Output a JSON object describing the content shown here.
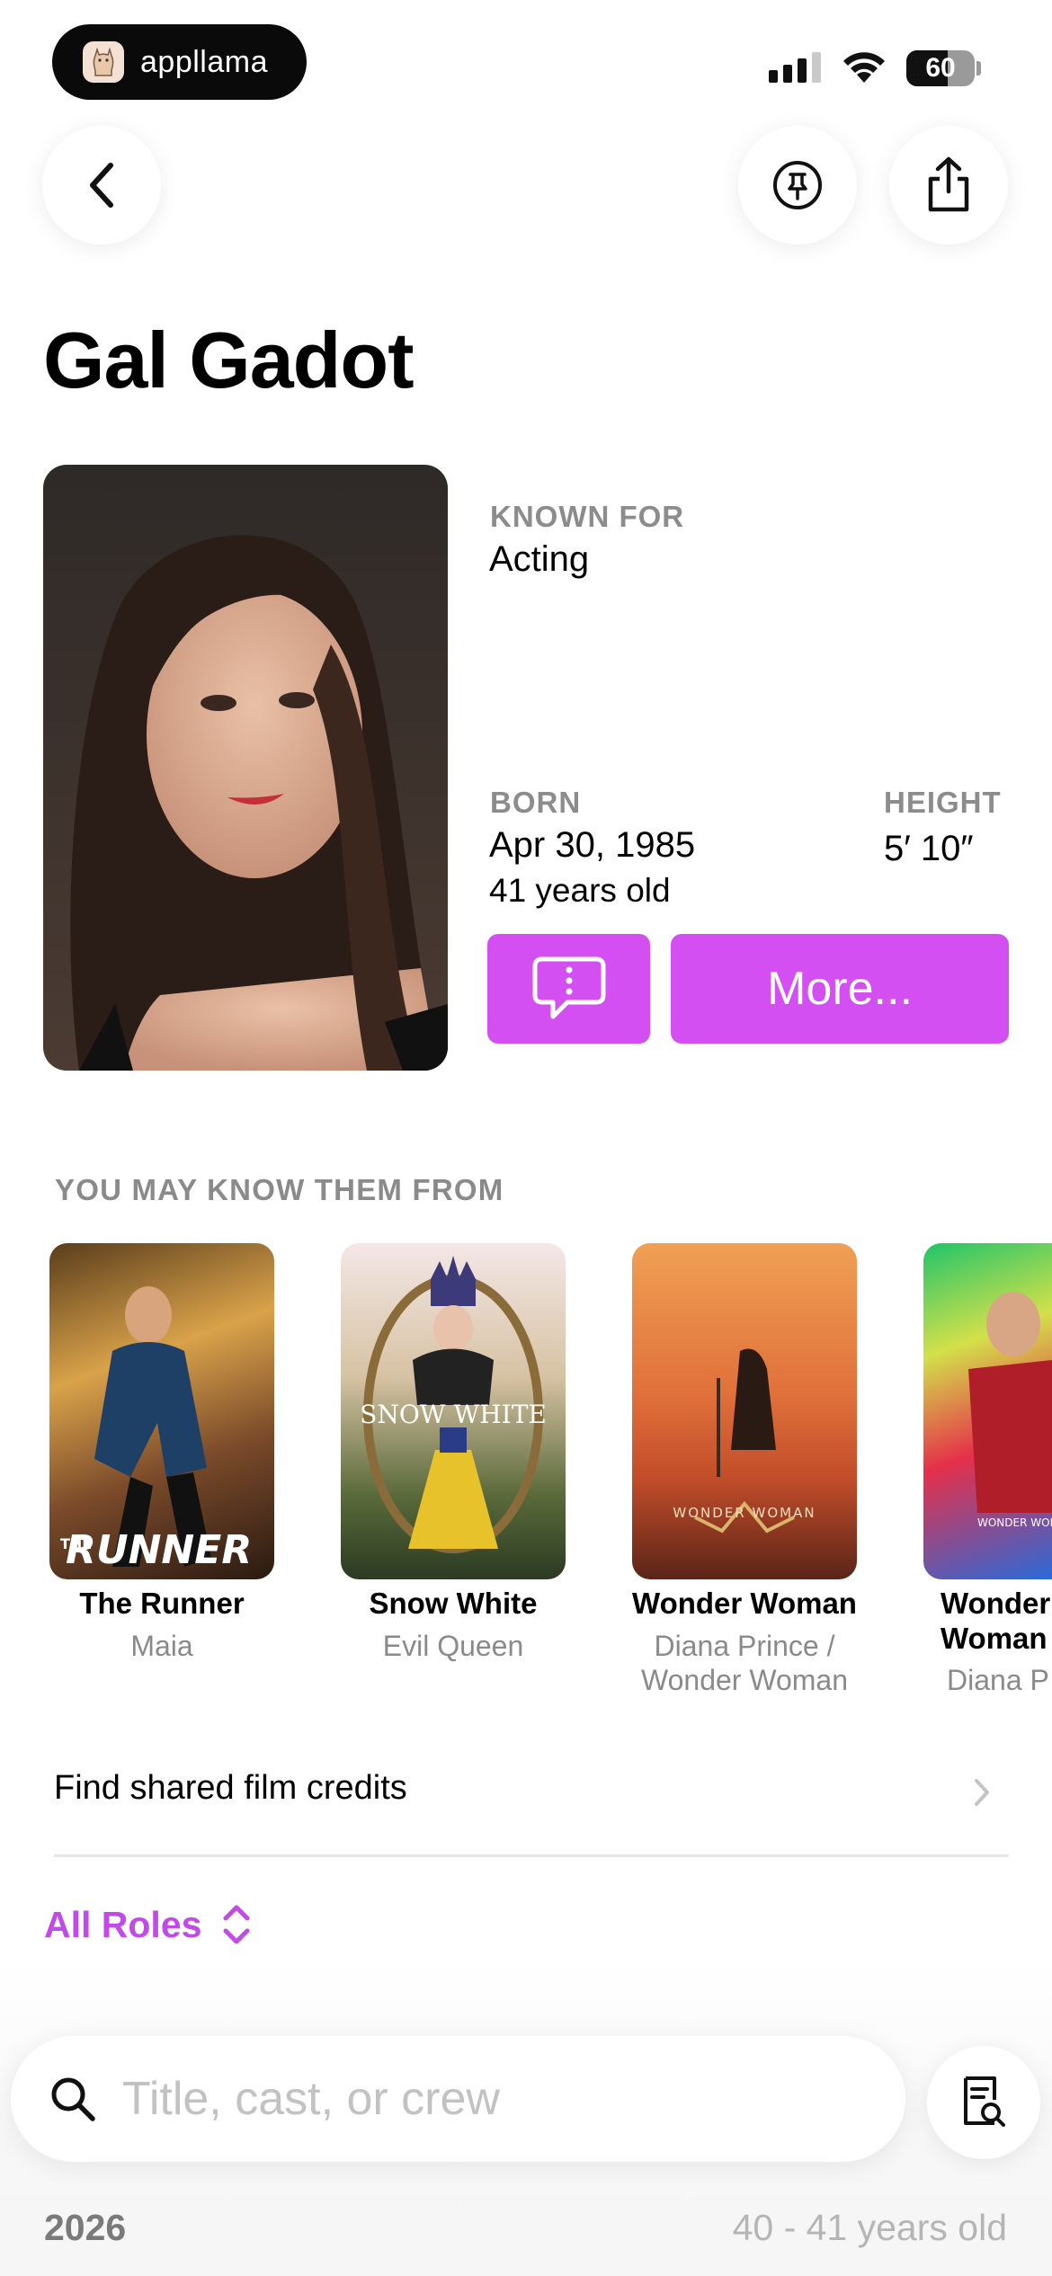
{
  "status_bar": {
    "app_badge": "appllama",
    "battery_level": "60",
    "battery_fraction": 0.6
  },
  "header": {
    "back_icon": "chevron-left-icon",
    "pin_icon": "pin-icon",
    "share_icon": "share-icon"
  },
  "person": {
    "name": "Gal Gadot",
    "known_for_label": "KNOWN FOR",
    "known_for": "Acting",
    "born_label": "BORN",
    "born_date": "Apr 30, 1985",
    "age": "41 years old",
    "height_label": "HEIGHT",
    "height": "5′ 10″"
  },
  "actions": {
    "comment_icon": "speech-bubble-exclamation-icon",
    "more_label": "More..."
  },
  "known_from": {
    "heading": "YOU MAY KNOW THEM FROM",
    "items": [
      {
        "title": "The Runner",
        "role": "Maia",
        "poster_text": "RUNNER",
        "poster_pretext": "THE"
      },
      {
        "title": "Snow White",
        "role": "Evil Queen",
        "poster_text": "SNOW WHITE"
      },
      {
        "title": "Wonder Woman",
        "role_line1": "Diana Prince /",
        "role_line2": "Wonder Woman",
        "poster_text": "WONDER WOMAN"
      },
      {
        "title_line1": "Wonder",
        "title_line2": "Woman",
        "role": "Diana P",
        "poster_text": "WONDER WOMA"
      }
    ]
  },
  "shared_credits": {
    "label": "Find shared film credits"
  },
  "filter": {
    "label": "All Roles"
  },
  "search": {
    "placeholder": "Title, cast, or crew"
  },
  "timeline": {
    "year": "2026",
    "age_range": "40 - 41 years old"
  }
}
